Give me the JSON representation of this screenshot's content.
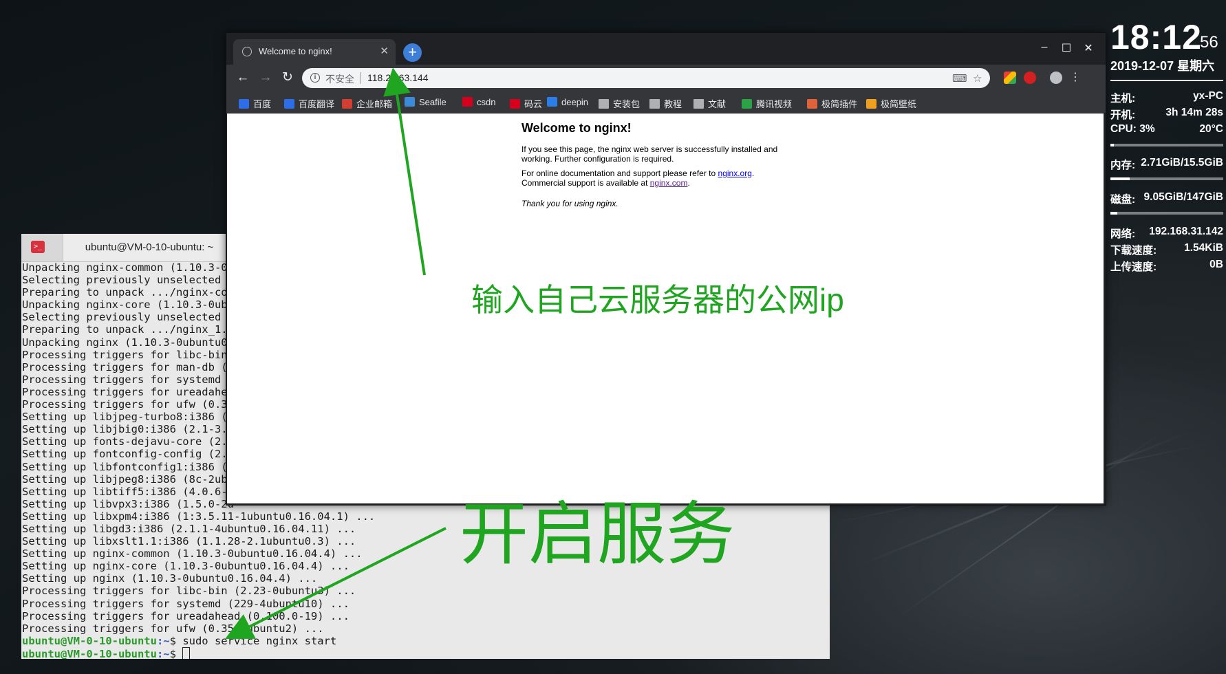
{
  "terminal": {
    "tab_title": "ubuntu@VM-0-10-ubuntu: ~",
    "lines": [
      "Unpacking nginx-common (1.10.3-0u",
      "Selecting previously unselected p",
      "Preparing to unpack .../nginx-cor",
      "Unpacking nginx-core (1.10.3-0ubu",
      "Selecting previously unselected p",
      "Preparing to unpack .../nginx_1.1",
      "Unpacking nginx (1.10.3-0ubuntu0.",
      "Processing triggers for libc-bin",
      "Processing triggers for man-db (2",
      "Processing triggers for systemd (",
      "Processing triggers for ureadahea",
      "Processing triggers for ufw (0.35",
      "Setting up libjpeg-turbo8:i386 (1",
      "Setting up libjbig0:i386 (2.1-3.1",
      "Setting up fonts-dejavu-core (2.3",
      "Setting up fontconfig-config (2.1",
      "Setting up libfontconfig1:i386 (2",
      "Setting up libjpeg8:i386 (8c-2ubu",
      "Setting up libtiff5:i386 (4.0.6-1",
      "Setting up libvpx3:i386 (1.5.0-2u",
      "Setting up libxpm4:i386 (1:3.5.11-1ubuntu0.16.04.1) ...",
      "Setting up libgd3:i386 (2.1.1-4ubuntu0.16.04.11) ...",
      "Setting up libxslt1.1:i386 (1.1.28-2.1ubuntu0.3) ...",
      "Setting up nginx-common (1.10.3-0ubuntu0.16.04.4) ...",
      "Setting up nginx-core (1.10.3-0ubuntu0.16.04.4) ...",
      "Setting up nginx (1.10.3-0ubuntu0.16.04.4) ...",
      "Processing triggers for libc-bin (2.23-0ubuntu3) ...",
      "Processing triggers for systemd (229-4ubuntu10) ...",
      "Processing triggers for ureadahead (0.100.0-19) ...",
      "Processing triggers for ufw (0.35-0ubuntu2) ..."
    ],
    "prompt_user": "ubuntu@VM-0-10-ubuntu",
    "prompt_path": ":~",
    "prompt_symbol": "$ ",
    "command": "sudo service nginx start"
  },
  "browser": {
    "tab_title": "Welcome to nginx!",
    "insecure_label": "不安全",
    "url": "118.25.63.144",
    "bookmarks": [
      "百度",
      "百度翻译",
      "企业邮箱",
      "Seafile",
      "csdn",
      "码云",
      "deepin",
      "安装包",
      "教程",
      "文献",
      "腾讯视频",
      "极简插件",
      "极简壁纸"
    ],
    "page": {
      "title": "Welcome to nginx!",
      "p1": "If you see this page, the nginx web server is successfully installed and working. Further configuration is required.",
      "p2_prefix": "For online documentation and support please refer to ",
      "link1": "nginx.org",
      "p2_mid": ".",
      "p2_line2_prefix": "Commercial support is available at ",
      "link2": "nginx.com",
      "p2_end": ".",
      "p3": "Thank you for using nginx."
    }
  },
  "monitor": {
    "time": "18:12",
    "seconds": "56",
    "date": "2019-12-07 星期六",
    "host_label": "主机:",
    "host_value": "yx-PC",
    "uptime_label": "开机:",
    "uptime_value": "3h 14m 28s",
    "cpu_label": "CPU: 3%",
    "cpu_temp": "20°C",
    "cpu_fraction": 0.03,
    "mem_label": "内存:",
    "mem_value": "2.71GiB/15.5GiB",
    "mem_fraction": 0.17,
    "disk_label": "磁盘:",
    "disk_value": "9.05GiB/147GiB",
    "disk_fraction": 0.06,
    "net_label": "网络:",
    "net_value": "192.168.31.142",
    "down_label": "下载速度:",
    "down_value": "1.54KiB",
    "up_label": "上传速度:",
    "up_value": "0B"
  },
  "annotations": {
    "ip_note": "输入自己云服务器的公网ip",
    "start_note": "开启服务"
  },
  "colors": {
    "annotation": "#1fa51f",
    "prompt_user": "#2a9a2a",
    "prompt_path": "#3b5fc0"
  }
}
